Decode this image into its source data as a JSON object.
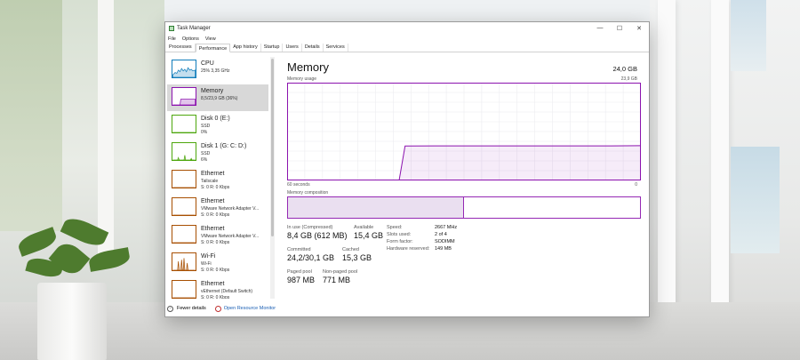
{
  "window": {
    "title": "Task Manager",
    "menu": [
      "File",
      "Options",
      "View"
    ],
    "tabs": [
      "Processes",
      "Performance",
      "App history",
      "Startup",
      "Users",
      "Details",
      "Services"
    ],
    "active_tab": "Performance",
    "controls": {
      "minimize": "—",
      "maximize": "☐",
      "close": "✕"
    }
  },
  "sidebar": {
    "items": [
      {
        "title": "CPU",
        "line1": "25% 3,35 GHz",
        "line2": "",
        "color": "#117dbb",
        "selected": false,
        "graph": "cpu"
      },
      {
        "title": "Memory",
        "line1": "8,5/23,9 GB (36%)",
        "line2": "",
        "color": "#8b12ae",
        "selected": true,
        "graph": "mem"
      },
      {
        "title": "Disk 0 (E:)",
        "line1": "SSD",
        "line2": "0%",
        "color": "#4da60c",
        "selected": false,
        "graph": "flat"
      },
      {
        "title": "Disk 1 (G: C: D:)",
        "line1": "SSD",
        "line2": "6%",
        "color": "#4da60c",
        "selected": false,
        "graph": "disk"
      },
      {
        "title": "Ethernet",
        "line1": "Tailscale",
        "line2": "S: 0 R: 0 Kbps",
        "color": "#a74f01",
        "selected": false,
        "graph": "flat"
      },
      {
        "title": "Ethernet",
        "line1": "VMware Network Adapter V...",
        "line2": "S: 0 R: 0 Kbps",
        "color": "#a74f01",
        "selected": false,
        "graph": "flat"
      },
      {
        "title": "Ethernet",
        "line1": "VMware Network Adapter V...",
        "line2": "S: 0 R: 0 Kbps",
        "color": "#a74f01",
        "selected": false,
        "graph": "flat"
      },
      {
        "title": "Wi-Fi",
        "line1": "Wi-Fi",
        "line2": "S: 0 R: 0 Kbps",
        "color": "#a74f01",
        "selected": false,
        "graph": "wifi"
      },
      {
        "title": "Ethernet",
        "line1": "vEthernet (Default Switch)",
        "line2": "S: 0 R: 0 Kbps",
        "color": "#a74f01",
        "selected": false,
        "graph": "flat"
      }
    ]
  },
  "footer": {
    "fewer_details": "Fewer details",
    "resource_monitor": "Open Resource Monitor"
  },
  "main": {
    "title": "Memory",
    "total": "24,0 GB",
    "usage_label": "Memory usage",
    "usage_max": "23,9 GB",
    "axis_left": "60 seconds",
    "axis_right": "0",
    "composition_label": "Memory composition",
    "composition_used_fraction": 0.5,
    "stats": {
      "in_use_label": "In use (Compressed)",
      "in_use_value": "8,4 GB (612 MB)",
      "available_label": "Available",
      "available_value": "15,4 GB",
      "committed_label": "Committed",
      "committed_value": "24,2/30,1 GB",
      "cached_label": "Cached",
      "cached_value": "15,3 GB",
      "paged_label": "Paged pool",
      "paged_value": "987 MB",
      "nonpaged_label": "Non-paged pool",
      "nonpaged_value": "771 MB"
    },
    "details": {
      "speed_label": "Speed:",
      "speed_value": "2667 MHz",
      "slots_label": "Slots used:",
      "slots_value": "2 of 4",
      "form_label": "Form factor:",
      "form_value": "SODIMM",
      "hw_label": "Hardware reserved:",
      "hw_value": "149 MB"
    }
  },
  "chart_data": {
    "type": "area",
    "title": "Memory usage",
    "xlabel": "60 seconds",
    "ylabel": "",
    "ylim": [
      0,
      23.9
    ],
    "x": [
      60,
      55,
      50,
      45,
      41,
      40,
      35,
      30,
      25,
      20,
      15,
      10,
      5,
      0
    ],
    "values": [
      0,
      0,
      0,
      0,
      0,
      8.4,
      8.45,
      8.45,
      8.45,
      8.45,
      8.45,
      8.45,
      8.45,
      8.5
    ],
    "grid": true,
    "color": "#8b12ae"
  }
}
